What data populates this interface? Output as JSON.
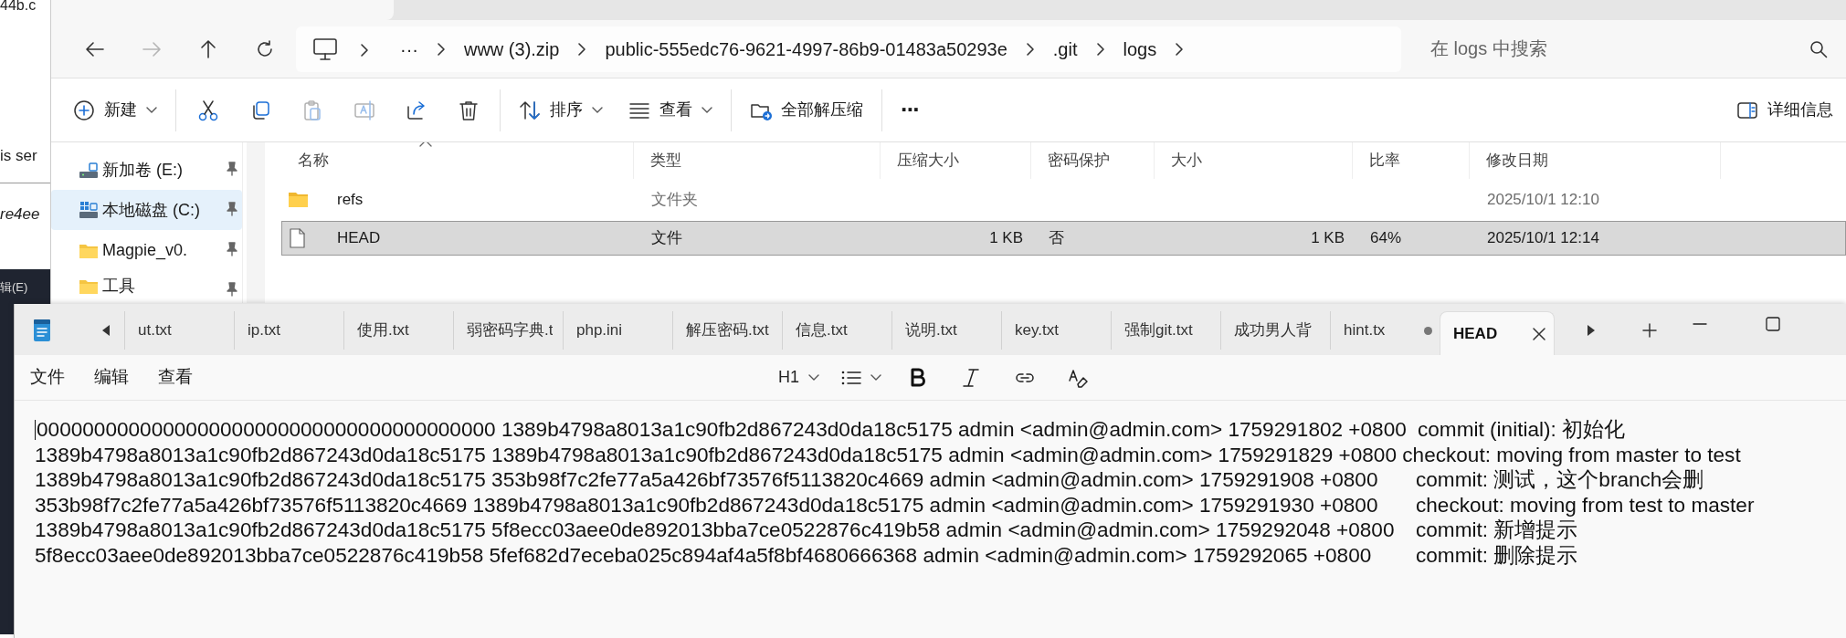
{
  "background_window": {
    "texts": [
      "44b.c",
      "is ser",
      "re4ee"
    ],
    "dark_label": "辑(E)"
  },
  "explorer": {
    "nav": [
      {
        "kind": "back",
        "disabled": false
      },
      {
        "kind": "forward",
        "disabled": true
      },
      {
        "kind": "up",
        "disabled": false
      },
      {
        "kind": "refresh",
        "disabled": false
      }
    ],
    "breadcrumb": [
      "···",
      "www (3).zip",
      "public-555edc76-9621-4997-86b9-01483a50293e",
      ".git",
      "logs"
    ],
    "search": {
      "placeholder": "在 logs 中搜索"
    },
    "toolbar": [
      {
        "kind": "new",
        "label": "新建",
        "dropdown": true,
        "disabled": false
      },
      {
        "kind": "sep"
      },
      {
        "kind": "cut",
        "disabled": false
      },
      {
        "kind": "copy",
        "disabled": false
      },
      {
        "kind": "paste",
        "disabled": true
      },
      {
        "kind": "rename",
        "disabled": true
      },
      {
        "kind": "share",
        "disabled": false
      },
      {
        "kind": "delete",
        "disabled": false
      },
      {
        "kind": "sep"
      },
      {
        "kind": "sort",
        "label": "排序",
        "dropdown": true,
        "disabled": false
      },
      {
        "kind": "view",
        "label": "查看",
        "dropdown": true,
        "disabled": false
      },
      {
        "kind": "sep"
      },
      {
        "kind": "extract",
        "label": "全部解压缩",
        "dropdown": false,
        "disabled": false
      },
      {
        "kind": "sep"
      },
      {
        "kind": "more",
        "label": "···"
      }
    ],
    "details_button": "详细信息",
    "sidebar": [
      {
        "kind": "drive",
        "label": "新加卷 (E:)",
        "selected": false
      },
      {
        "kind": "system-drive",
        "label": "本地磁盘 (C:)",
        "selected": true
      },
      {
        "kind": "folder",
        "label": "Magpie_v0.",
        "selected": false
      },
      {
        "kind": "folder",
        "label": "工具",
        "selected": false
      }
    ],
    "columns": [
      "名称",
      "类型",
      "压缩大小",
      "密码保护",
      "大小",
      "比率",
      "修改日期"
    ],
    "rows": [
      {
        "kind": "folder",
        "selected": false,
        "cells": [
          "refs",
          "文件夹",
          "",
          "",
          "",
          "",
          "2025/10/1 12:10"
        ]
      },
      {
        "kind": "file",
        "selected": true,
        "cells": [
          "HEAD",
          "文件",
          "1 KB",
          "否",
          "1 KB",
          "64%",
          "2025/10/1 12:14"
        ]
      }
    ]
  },
  "notepad": {
    "tabs": [
      {
        "label": "ut.txt",
        "selected": false,
        "modified": false
      },
      {
        "label": "ip.txt",
        "selected": false,
        "modified": false
      },
      {
        "label": "使用.txt",
        "selected": false,
        "modified": false
      },
      {
        "label": "弱密码字典.t",
        "selected": false,
        "modified": false
      },
      {
        "label": "php.ini",
        "selected": false,
        "modified": false
      },
      {
        "label": "解压密码.txt",
        "selected": false,
        "modified": false
      },
      {
        "label": "信息.txt",
        "selected": false,
        "modified": false
      },
      {
        "label": "说明.txt",
        "selected": false,
        "modified": false
      },
      {
        "label": "key.txt",
        "selected": false,
        "modified": false
      },
      {
        "label": "强制git.txt",
        "selected": false,
        "modified": false
      },
      {
        "label": "成功男人背",
        "selected": false,
        "modified": false
      },
      {
        "label": "hint.tx",
        "selected": false,
        "modified": true
      },
      {
        "label": "HEAD",
        "selected": true,
        "modified": false
      }
    ],
    "menu": [
      "文件",
      "编辑",
      "查看"
    ],
    "heading_button": "H1",
    "lines": [
      "0000000000000000000000000000000000000000 1389b4798a8013a1c90fb2d867243d0da18c5175 admin <admin@admin.com> 1759291802 +0800\tcommit (initial): 初始化",
      "1389b4798a8013a1c90fb2d867243d0da18c5175 1389b4798a8013a1c90fb2d867243d0da18c5175 admin <admin@admin.com> 1759291829 +0800 checkout: moving from master to test",
      "1389b4798a8013a1c90fb2d867243d0da18c5175 353b98f7c2fe77a5a426bf73576f5113820c4669 admin <admin@admin.com> 1759291908 +0800\tcommit: 测试，这个branch会删",
      "353b98f7c2fe77a5a426bf73576f5113820c4669 1389b4798a8013a1c90fb2d867243d0da18c5175 admin <admin@admin.com> 1759291930 +0800\tcheckout: moving from test to master",
      "1389b4798a8013a1c90fb2d867243d0da18c5175 5f8ecc03aee0de892013bba7ce0522876c419b58 admin <admin@admin.com> 1759292048 +0800\tcommit: 新增提示",
      "5f8ecc03aee0de892013bba7ce0522876c419b58 5fef682d7eceba025c894af4a5f8bf4680666368 admin <admin@admin.com> 1759292065 +0800\tcommit: 删除提示"
    ]
  }
}
